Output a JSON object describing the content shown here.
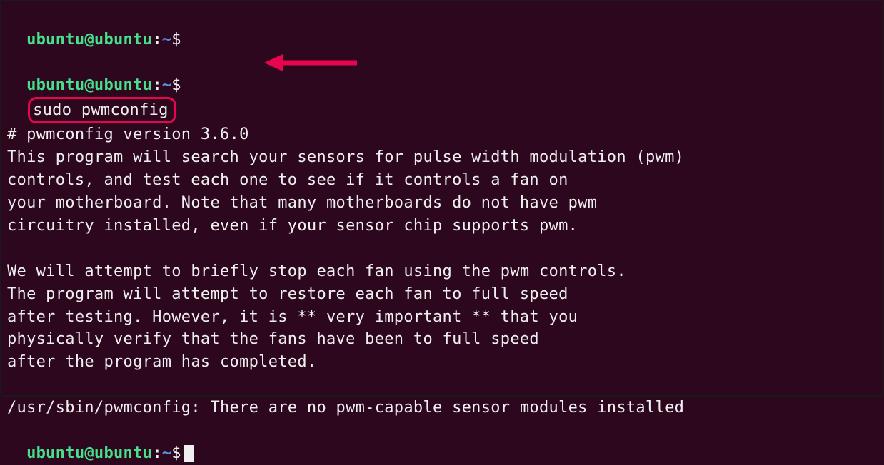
{
  "prompt": {
    "user": "ubuntu@ubuntu",
    "colon": ":",
    "path": "~",
    "dollar": "$"
  },
  "command": "sudo pwmconfig",
  "output": {
    "version_line": "# pwmconfig version 3.6.0",
    "para1_l1": "This program will search your sensors for pulse width modulation (pwm)",
    "para1_l2": "controls, and test each one to see if it controls a fan on",
    "para1_l3": "your motherboard. Note that many motherboards do not have pwm",
    "para1_l4": "circuitry installed, even if your sensor chip supports pwm.",
    "blank": " ",
    "para2_l1": "We will attempt to briefly stop each fan using the pwm controls.",
    "para2_l2": "The program will attempt to restore each fan to full speed",
    "para2_l3": "after testing. However, it is ** very important ** that you",
    "para2_l4": "physically verify that the fans have been to full speed",
    "para2_l5": "after the program has completed.",
    "result": "/usr/sbin/pwmconfig: There are no pwm-capable sensor modules installed"
  },
  "annotation": {
    "arrow_color": "#e7054f"
  }
}
